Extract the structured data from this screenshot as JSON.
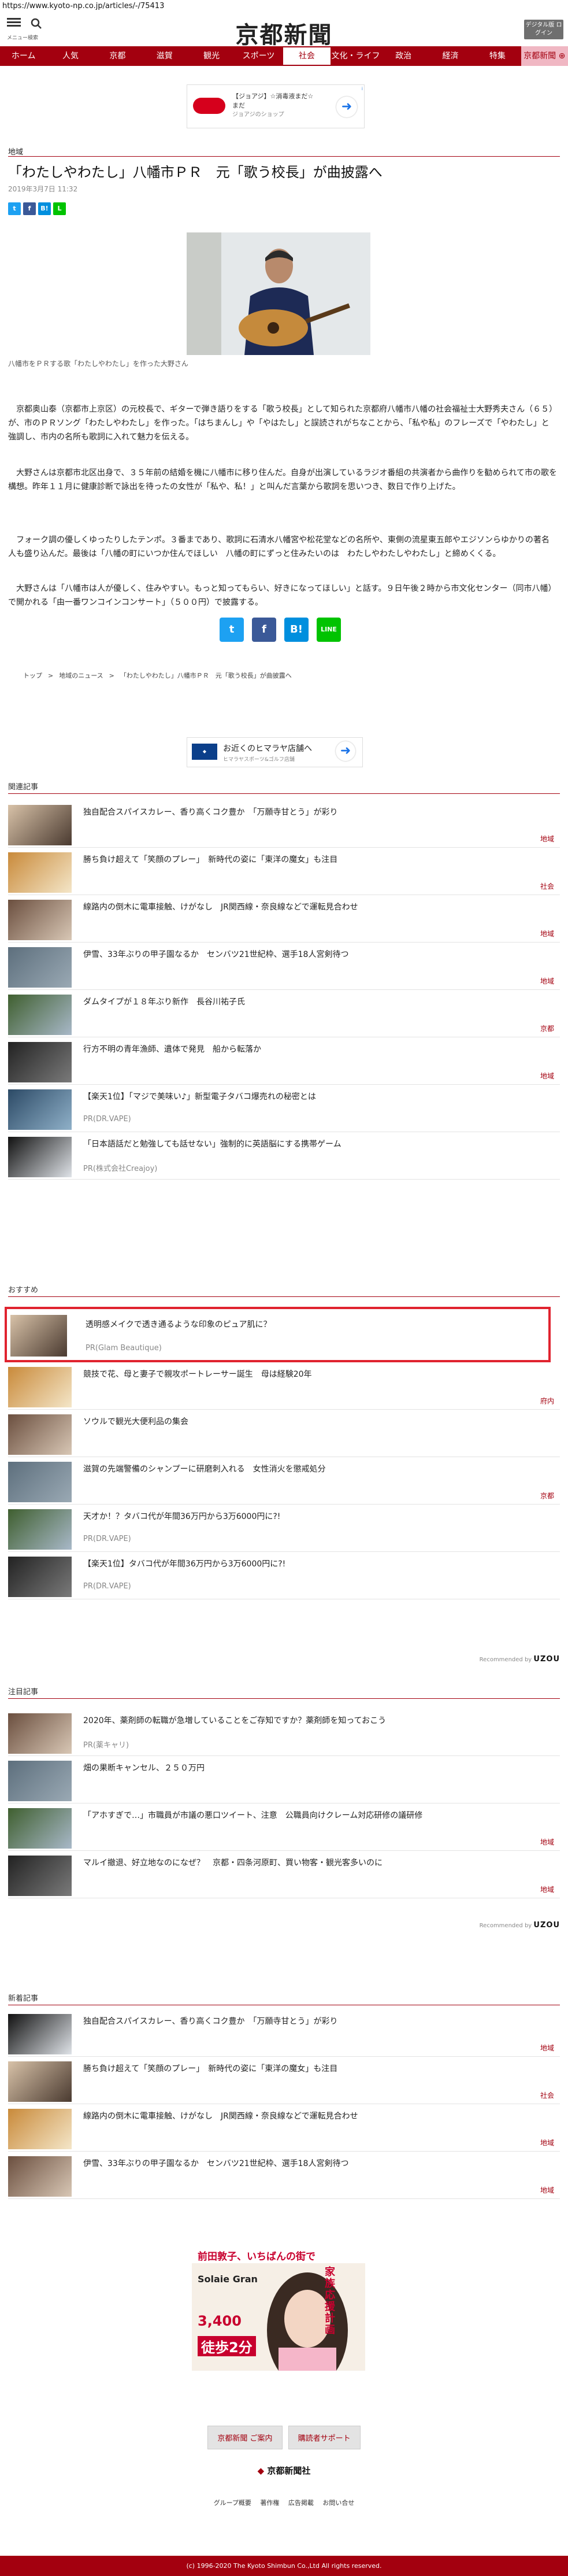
{
  "browser": {
    "url": "https://www.kyoto-np.co.jp/articles/-/75413"
  },
  "header": {
    "menu_label": "メニュー",
    "search_label": "検索",
    "logo": "京都新聞",
    "digital_button": "デジタル版 ログイン"
  },
  "nav": {
    "items": [
      "ホーム",
      "人気",
      "京都",
      "滋賀",
      "観光",
      "スポーツ",
      "社会",
      "文化・ライフ",
      "政治",
      "経済",
      "特集",
      "京都新聞 ⊕"
    ],
    "active_index": 6
  },
  "top_ad": {
    "text": "【ジョアジ】☆消毒液まだ☆まだ",
    "sub": "ジョアジのショップ",
    "info": "i"
  },
  "article": {
    "section": "地域",
    "title": "「わたしやわたし」八幡市ＰＲ　元「歌う校長」が曲披露へ",
    "date": "2019年3月7日 11:32",
    "caption": "八幡市をＰＲする歌「わたしやわたし」を作った大野さん",
    "paragraphs": [
      "　京都奥山泰（京都市上京区）の元校長で、ギターで弾き語りをする「歌う校長」として知られた京都府八幡市八幡の社会福祉士大野秀夫さん（６５）が、市のＰＲソング「わたしやわたし」を作った。「はちまんし」や「やはたし」と誤読されがちなことから、「私や私」のフレーズで「やわたし」と強調し、市内の名所も歌詞に入れて魅力を伝える。",
      "　大野さんは京都市北区出身で、３５年前の結婚を機に八幡市に移り住んだ。自身が出演しているラジオ番組の共演者から曲作りを勧められて市の歌を構想。昨年１１月に健康診断で詠出を待ったの女性が「私や、私！」と叫んだ言葉から歌詞を思いつき、数日で作り上げた。",
      "　フォーク調の優しくゆったりしたテンポ。３番まであり、歌詞に石清水八幡宮や松花堂などの名所や、東側の流星東五郎やエジソンらゆかりの著名人も盛り込んだ。最後は「八幡の町にいつか住んでほしい　八幡の町にずっと住みたいのは　わたしやわたしやわたし」と締めくくる。",
      "　大野さんは「八幡市は人が優しく、住みやすい。もっと知ってもらい、好きになってほしい」と話す。９日午後２時から市文化センター（同市八幡）で開かれる「由一番ワンコインコンサート」（５００円）で披露する。"
    ]
  },
  "share": {
    "twitter": "t",
    "facebook": "f",
    "hatena": "B!",
    "line": "LINE"
  },
  "breadcrumb": [
    "トップ",
    ">",
    "地域のニュース",
    ">",
    "「わたしやわたし」八幡市ＰＲ　元「歌う校長」が曲披露へ"
  ],
  "mid_ad": {
    "text": "お近くのヒマラヤ店舗へ",
    "sub": "ヒマラヤスポーツ&ゴルフ店舗"
  },
  "related": {
    "heading": "関連記事",
    "items": [
      {
        "title": "独自配合スパイスカレー、香り高くコク豊か　「万願寺甘とう」が彩り",
        "cat": "地域",
        "pr": ""
      },
      {
        "title": "勝ち負け超えて「笑顔のプレー」　新時代の姿に「東洋の魔女」も注目",
        "cat": "社会",
        "pr": ""
      },
      {
        "title": "線路内の倒木に電車接触、けがなし　JR関西線・奈良線などで運転見合わせ",
        "cat": "地域",
        "pr": ""
      },
      {
        "title": "伊雪、33年ぶりの甲子園なるか　センバツ21世紀枠、選手18人宮剣待つ",
        "cat": "地域",
        "pr": ""
      },
      {
        "title": "ダムタイプが１８年ぶり新作　長谷川祐子氏",
        "cat": "京都",
        "pr": ""
      },
      {
        "title": "行方不明の青年漁師、遺体で発見　船から転落か",
        "cat": "地域",
        "pr": ""
      },
      {
        "title": "【楽天1位】「マジで美味い♪」新型電子タバコ爆売れの秘密とは",
        "cat": "",
        "pr": "PR(DR.VAPE)"
      },
      {
        "title": "「日本語話だと勉強しても話せない」強制的に英語脳にする携帯ゲーム",
        "cat": "",
        "pr": "PR(株式会社Creajoy)"
      }
    ]
  },
  "osusume": {
    "heading": "おすすめ",
    "items": [
      {
        "title": "透明感メイクで透き通るような印象のピュア肌に？",
        "cat": "",
        "pr": "PR(Glam Beautique)",
        "highlight": true
      },
      {
        "title": "競技で花、母と妻子で親攻ポートレーサー誕生　母は経験20年",
        "cat": "府内",
        "pr": ""
      },
      {
        "title": "ソウルで観光大便利品の集会",
        "cat": "",
        "pr": ""
      },
      {
        "title": "滋賀の先端警備のシャンプーに研磨刺入れる　女性消火を懲戒処分",
        "cat": "京都",
        "pr": ""
      },
      {
        "title": "天才か！？タバコ代が年間36万円から3万6000円に?!",
        "cat": "",
        "pr": "PR(DR.VAPE)"
      },
      {
        "title": "【楽天1位】タバコ代が年間36万円から3万6000円に?!",
        "cat": "",
        "pr": "PR(DR.VAPE)"
      }
    ],
    "recommended": "Recommended by",
    "brand": "UZOU"
  },
  "attention": {
    "heading": "注目記事",
    "items": [
      {
        "title": "2020年、薬剤師の転職が急増していることをご存知ですか？薬剤師を知っておこう",
        "cat": "",
        "pr": "PR(薬キャリ)"
      },
      {
        "title": "畑の果断キャンセル、２５０万円",
        "cat": "",
        "pr": ""
      },
      {
        "title": "「アホすぎで…」市職員が市議の悪口ツイート、注意　公職員向けクレーム対応研修の議研修",
        "cat": "地域",
        "pr": ""
      },
      {
        "title": "マルイ撤退、好立地なのになぜ？　京都・四条河原町、買い物客・観光客多いのに",
        "cat": "地域",
        "pr": ""
      }
    ],
    "recommended": "Recommended by",
    "brand": "UZOU"
  },
  "latest": {
    "heading": "新着記事",
    "items": [
      {
        "title": "独自配合スパイスカレー、香り高くコク豊か　「万願寺甘とう」が彩り",
        "cat": "地域",
        "pr": ""
      },
      {
        "title": "勝ち負け超えて「笑顔のプレー」　新時代の姿に「東洋の魔女」も注目",
        "cat": "社会",
        "pr": ""
      },
      {
        "title": "線路内の倒木に電車接触、けがなし　JR関西線・奈良線などで運転見合わせ",
        "cat": "地域",
        "pr": ""
      },
      {
        "title": "伊雪、33年ぶりの甲子園なるか　センバツ21世紀枠、選手18人宮剣待つ",
        "cat": "地域",
        "pr": ""
      }
    ]
  },
  "banner": {
    "line1": "前田敦子、いちばんの街で",
    "line2": "家族応援計画",
    "brand": "Solaie Gran",
    "price": "3,400",
    "walk": "徒歩2分"
  },
  "footer": {
    "buttons": [
      "京都新聞 ご案内",
      "購読者サポート"
    ],
    "logo": "京都新聞社",
    "links": [
      "グループ概要",
      "著作権",
      "広告掲載",
      "お問い合せ"
    ],
    "copyright": "(c) 1996-2020 The Kyoto Shimbun Co.,Ltd All rights reserved."
  },
  "colors": {
    "brand": "#a3000f",
    "nav_highlight": "#f0b7c3",
    "highlight_border": "#e0232f"
  }
}
